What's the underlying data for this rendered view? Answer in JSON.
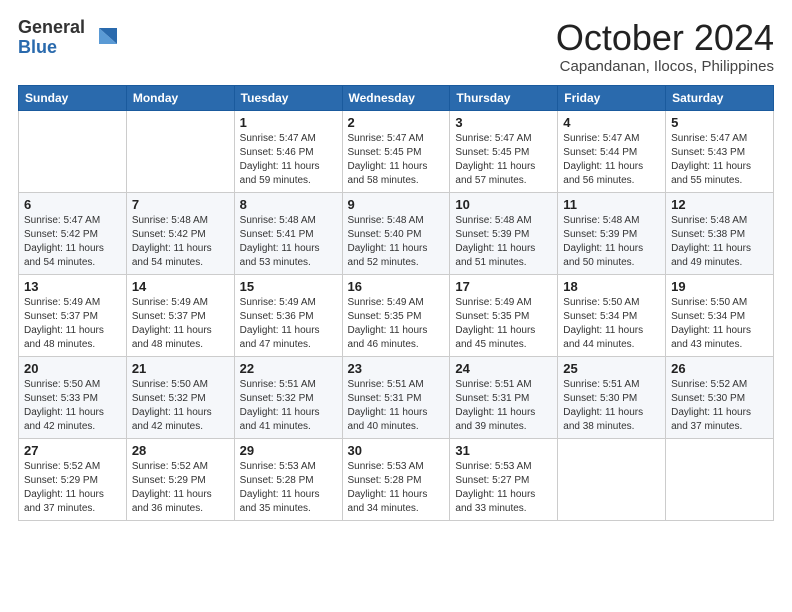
{
  "logo": {
    "general": "General",
    "blue": "Blue"
  },
  "title": "October 2024",
  "location": "Capandanan, Ilocos, Philippines",
  "weekdays": [
    "Sunday",
    "Monday",
    "Tuesday",
    "Wednesday",
    "Thursday",
    "Friday",
    "Saturday"
  ],
  "weeks": [
    [
      {
        "day": "",
        "info": ""
      },
      {
        "day": "",
        "info": ""
      },
      {
        "day": "1",
        "info": "Sunrise: 5:47 AM\nSunset: 5:46 PM\nDaylight: 11 hours and 59 minutes."
      },
      {
        "day": "2",
        "info": "Sunrise: 5:47 AM\nSunset: 5:45 PM\nDaylight: 11 hours and 58 minutes."
      },
      {
        "day": "3",
        "info": "Sunrise: 5:47 AM\nSunset: 5:45 PM\nDaylight: 11 hours and 57 minutes."
      },
      {
        "day": "4",
        "info": "Sunrise: 5:47 AM\nSunset: 5:44 PM\nDaylight: 11 hours and 56 minutes."
      },
      {
        "day": "5",
        "info": "Sunrise: 5:47 AM\nSunset: 5:43 PM\nDaylight: 11 hours and 55 minutes."
      }
    ],
    [
      {
        "day": "6",
        "info": "Sunrise: 5:47 AM\nSunset: 5:42 PM\nDaylight: 11 hours and 54 minutes."
      },
      {
        "day": "7",
        "info": "Sunrise: 5:48 AM\nSunset: 5:42 PM\nDaylight: 11 hours and 54 minutes."
      },
      {
        "day": "8",
        "info": "Sunrise: 5:48 AM\nSunset: 5:41 PM\nDaylight: 11 hours and 53 minutes."
      },
      {
        "day": "9",
        "info": "Sunrise: 5:48 AM\nSunset: 5:40 PM\nDaylight: 11 hours and 52 minutes."
      },
      {
        "day": "10",
        "info": "Sunrise: 5:48 AM\nSunset: 5:39 PM\nDaylight: 11 hours and 51 minutes."
      },
      {
        "day": "11",
        "info": "Sunrise: 5:48 AM\nSunset: 5:39 PM\nDaylight: 11 hours and 50 minutes."
      },
      {
        "day": "12",
        "info": "Sunrise: 5:48 AM\nSunset: 5:38 PM\nDaylight: 11 hours and 49 minutes."
      }
    ],
    [
      {
        "day": "13",
        "info": "Sunrise: 5:49 AM\nSunset: 5:37 PM\nDaylight: 11 hours and 48 minutes."
      },
      {
        "day": "14",
        "info": "Sunrise: 5:49 AM\nSunset: 5:37 PM\nDaylight: 11 hours and 48 minutes."
      },
      {
        "day": "15",
        "info": "Sunrise: 5:49 AM\nSunset: 5:36 PM\nDaylight: 11 hours and 47 minutes."
      },
      {
        "day": "16",
        "info": "Sunrise: 5:49 AM\nSunset: 5:35 PM\nDaylight: 11 hours and 46 minutes."
      },
      {
        "day": "17",
        "info": "Sunrise: 5:49 AM\nSunset: 5:35 PM\nDaylight: 11 hours and 45 minutes."
      },
      {
        "day": "18",
        "info": "Sunrise: 5:50 AM\nSunset: 5:34 PM\nDaylight: 11 hours and 44 minutes."
      },
      {
        "day": "19",
        "info": "Sunrise: 5:50 AM\nSunset: 5:34 PM\nDaylight: 11 hours and 43 minutes."
      }
    ],
    [
      {
        "day": "20",
        "info": "Sunrise: 5:50 AM\nSunset: 5:33 PM\nDaylight: 11 hours and 42 minutes."
      },
      {
        "day": "21",
        "info": "Sunrise: 5:50 AM\nSunset: 5:32 PM\nDaylight: 11 hours and 42 minutes."
      },
      {
        "day": "22",
        "info": "Sunrise: 5:51 AM\nSunset: 5:32 PM\nDaylight: 11 hours and 41 minutes."
      },
      {
        "day": "23",
        "info": "Sunrise: 5:51 AM\nSunset: 5:31 PM\nDaylight: 11 hours and 40 minutes."
      },
      {
        "day": "24",
        "info": "Sunrise: 5:51 AM\nSunset: 5:31 PM\nDaylight: 11 hours and 39 minutes."
      },
      {
        "day": "25",
        "info": "Sunrise: 5:51 AM\nSunset: 5:30 PM\nDaylight: 11 hours and 38 minutes."
      },
      {
        "day": "26",
        "info": "Sunrise: 5:52 AM\nSunset: 5:30 PM\nDaylight: 11 hours and 37 minutes."
      }
    ],
    [
      {
        "day": "27",
        "info": "Sunrise: 5:52 AM\nSunset: 5:29 PM\nDaylight: 11 hours and 37 minutes."
      },
      {
        "day": "28",
        "info": "Sunrise: 5:52 AM\nSunset: 5:29 PM\nDaylight: 11 hours and 36 minutes."
      },
      {
        "day": "29",
        "info": "Sunrise: 5:53 AM\nSunset: 5:28 PM\nDaylight: 11 hours and 35 minutes."
      },
      {
        "day": "30",
        "info": "Sunrise: 5:53 AM\nSunset: 5:28 PM\nDaylight: 11 hours and 34 minutes."
      },
      {
        "day": "31",
        "info": "Sunrise: 5:53 AM\nSunset: 5:27 PM\nDaylight: 11 hours and 33 minutes."
      },
      {
        "day": "",
        "info": ""
      },
      {
        "day": "",
        "info": ""
      }
    ]
  ]
}
